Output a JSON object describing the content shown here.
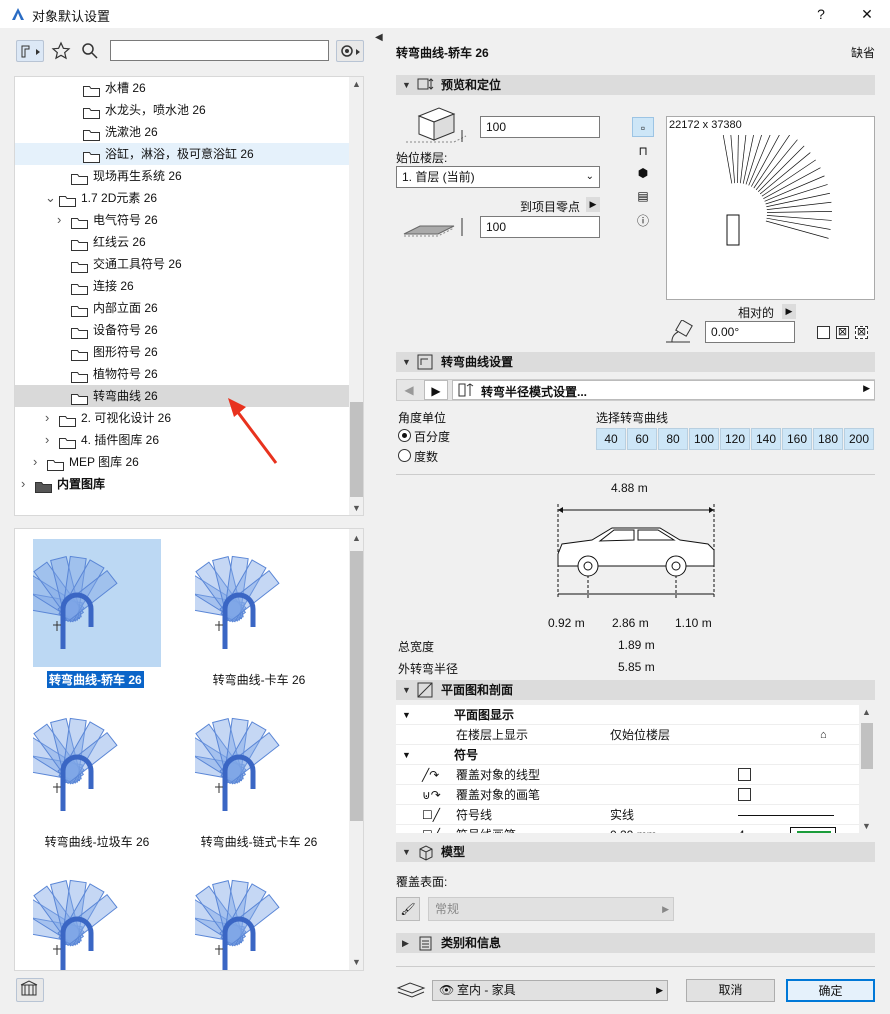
{
  "window": {
    "title": "对象默认设置",
    "help": "?",
    "close": "✕"
  },
  "tree": {
    "items": [
      {
        "label": "水槽 26",
        "indent": 3,
        "selected": false
      },
      {
        "label": "水龙头，喷水池 26",
        "indent": 3,
        "selected": false
      },
      {
        "label": "洗漱池 26",
        "indent": 3,
        "selected": false
      },
      {
        "label": "浴缸，淋浴，极可意浴缸 26",
        "indent": 3,
        "selected": true
      },
      {
        "label": "现场再生系统 26",
        "indent": 2,
        "selected": false
      },
      {
        "label": "1.7 2D元素 26",
        "indent": 1,
        "expanded": true
      },
      {
        "label": "电气符号 26",
        "indent": 2,
        "collapsed": true
      },
      {
        "label": "红线云 26",
        "indent": 2
      },
      {
        "label": "交通工具符号 26",
        "indent": 2
      },
      {
        "label": "连接 26",
        "indent": 2
      },
      {
        "label": "内部立面 26",
        "indent": 2
      },
      {
        "label": "设备符号 26",
        "indent": 2
      },
      {
        "label": "图形符号 26",
        "indent": 2
      },
      {
        "label": "植物符号 26",
        "indent": 2
      },
      {
        "label": "转弯曲线 26",
        "indent": 2,
        "active": true
      },
      {
        "label": "2. 可视化设计 26",
        "indent": 1,
        "collapsed": true
      },
      {
        "label": "4. 插件图库 26",
        "indent": 1,
        "collapsed": true
      },
      {
        "label": "MEP 图库 26",
        "indent": 0,
        "collapsed": true
      },
      {
        "label": "内置图库",
        "indent": -1,
        "collapsed": true,
        "bold": true
      }
    ]
  },
  "thumbnails": [
    {
      "label": "转弯曲线-轿车 26",
      "selected": true
    },
    {
      "label": "转弯曲线-卡车 26"
    },
    {
      "label": "转弯曲线-垃圾车 26"
    },
    {
      "label": "转弯曲线-链式卡车 26"
    }
  ],
  "header": {
    "title": "转弯曲线-轿车 26",
    "default": "缺省"
  },
  "sections": {
    "preview": "预览和定位",
    "settings": "转弯曲线设置",
    "plan": "平面图和剖面",
    "model": "模型",
    "category": "类别和信息"
  },
  "positioning": {
    "height_value": "100",
    "home_story_label": "始位楼层:",
    "home_story_value": "1. 首层 (当前)",
    "to_project_zero": "到项目零点",
    "offset_value": "100",
    "preview_size": "22172 x 37380",
    "relative_label": "相对的",
    "angle_value": "0.00°"
  },
  "settings": {
    "tab_label": "转弯半径模式设置...",
    "angle_unit_label": "角度单位",
    "unit_percent": "百分度",
    "unit_degree": "度数",
    "select_curve_label": "选择转弯曲线",
    "curve_values": [
      "40",
      "60",
      "80",
      "100",
      "120",
      "140",
      "160",
      "180",
      "200"
    ],
    "car_length": "4.88 m",
    "front_overhang": "0.92 m",
    "wheelbase": "2.86 m",
    "rear_overhang": "1.10 m",
    "total_width_label": "总宽度",
    "total_width": "1.89 m",
    "outer_radius_label": "外转弯半径",
    "outer_radius": "5.85 m"
  },
  "plan": {
    "rows": [
      {
        "label": "平面图显示",
        "value": "",
        "group": true
      },
      {
        "label": "在楼层上显示",
        "value": "仅始位楼层"
      },
      {
        "label": "符号",
        "value": "",
        "group": true,
        "top": true
      },
      {
        "label": "覆盖对象的线型",
        "value": ""
      },
      {
        "label": "覆盖对象的画笔",
        "value": ""
      },
      {
        "label": "符号线",
        "value": "实线"
      },
      {
        "label": "符号线画笔",
        "value": "0.20 mm",
        "extra": "4"
      }
    ]
  },
  "model": {
    "surface_label": "覆盖表面:",
    "surface_value": "常规"
  },
  "footer": {
    "layer": "室内 - 家具",
    "cancel": "取消",
    "ok": "确定"
  }
}
